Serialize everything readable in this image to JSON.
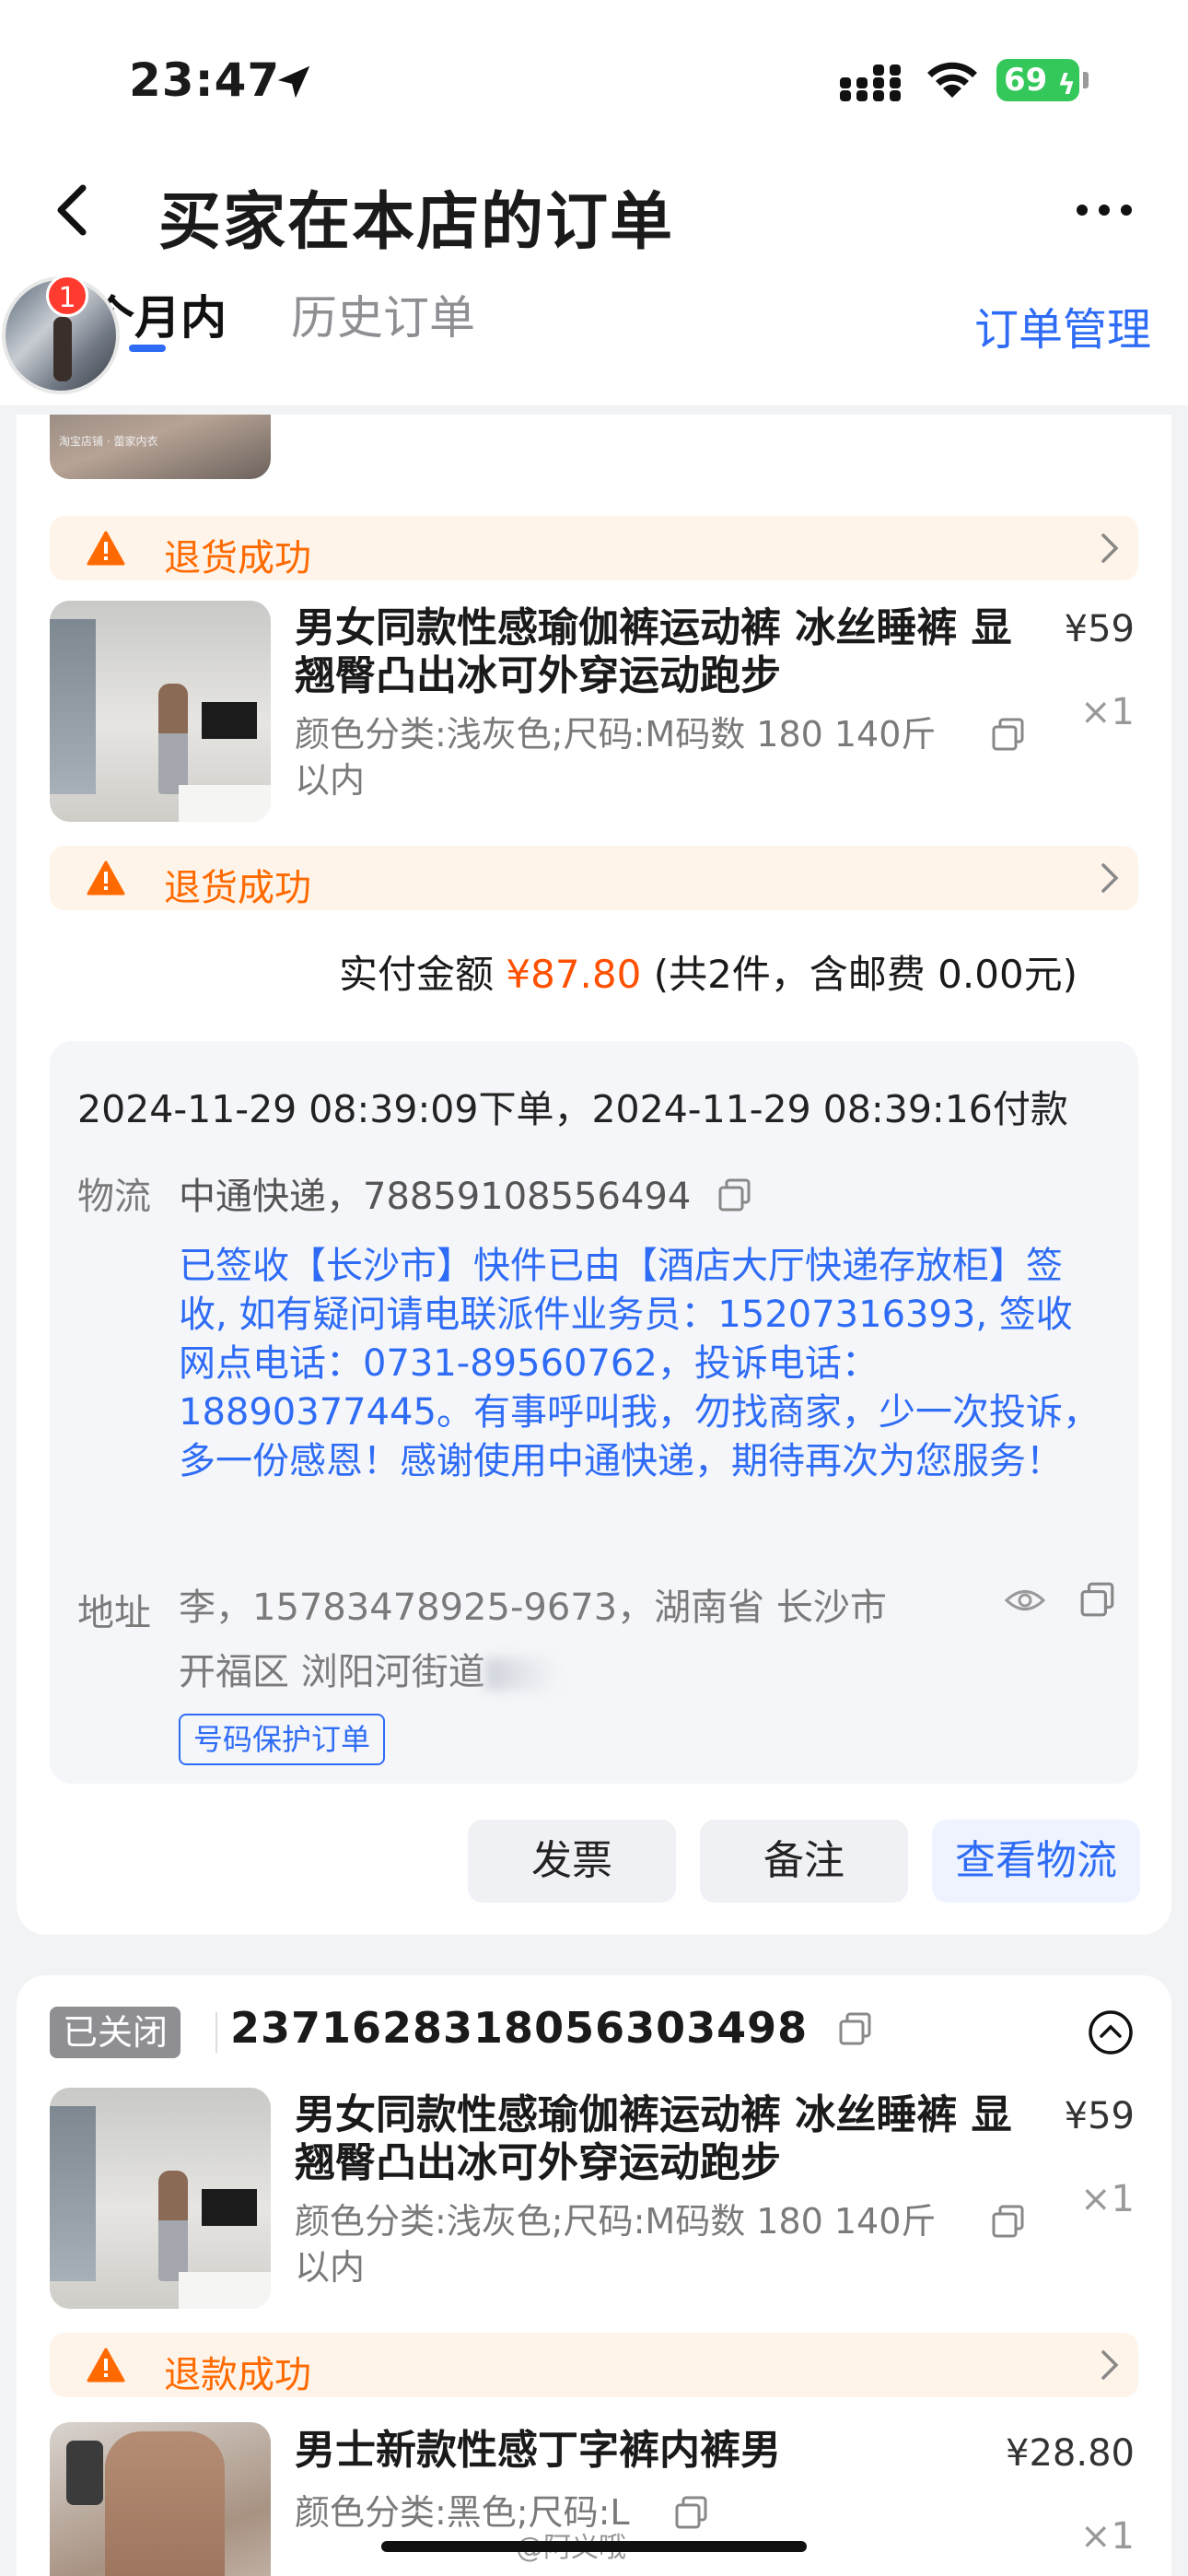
{
  "status": {
    "time": "23:47",
    "battery": "69"
  },
  "header": {
    "title": "买家在本店的订单",
    "tabs": [
      "个月内",
      "历史订单"
    ],
    "manage": "订单管理",
    "badge": "1"
  },
  "order1": {
    "thumb_text": "淘宝店铺 · 蕾家内衣",
    "items": [
      {
        "notice": "退货成功",
        "title": "男女同款性感瑜伽裤运动裤 冰丝睡裤 显翘臀凸出冰可外穿运动跑步",
        "sku": "颜色分类:浅灰色;尺码:M码数 180  140斤以内",
        "price": "¥59",
        "qty": "×1",
        "notice_after": "退货成功"
      }
    ],
    "paid_label": "实付金额",
    "paid_amount": "¥87.80",
    "paid_note": "(共2件，含邮费 0.00元)",
    "order_time": "2024-11-29 08:39:09下单，2024-11-29 08:39:16付款",
    "logistics_label": "物流",
    "logistics_head": "中通快递，78859108556494",
    "logistics_detail": "已签收【长沙市】快件已由【酒店大厅快递存放柜】签收, 如有疑问请电联派件业务员：15207316393, 签收网点电话：0731-89560762，投诉电话：18890377445。有事呼叫我，勿找商家，少一次投诉，多一份感恩！感谢使用中通快递，期待再次为您服务！",
    "address_label": "地址",
    "address_line1": "李，15783478925-9673，湖南省 长沙市",
    "address_line2": "开福区 浏阳河街道",
    "protect_tag": "号码保护订单",
    "buttons": [
      "发票",
      "备注",
      "查看物流"
    ]
  },
  "order2": {
    "status": "已关闭",
    "order_no": "2371628318056303498",
    "items": [
      {
        "title": "男女同款性感瑜伽裤运动裤 冰丝睡裤 显翘臀凸出冰可外穿运动跑步",
        "sku": "颜色分类:浅灰色;尺码:M码数 180  140斤以内",
        "price": "¥59",
        "qty": "×1",
        "notice": "退款成功"
      },
      {
        "title": "男士新款性感丁字裤内裤男",
        "sku": "颜色分类:黑色;尺码:L",
        "price": "¥28.80",
        "qty": "×1"
      }
    ]
  },
  "watermark": "@阿义哦",
  "colors": {
    "accent": "#2f6cf6",
    "warn": "#ff6a00",
    "price": "#ff5000"
  }
}
